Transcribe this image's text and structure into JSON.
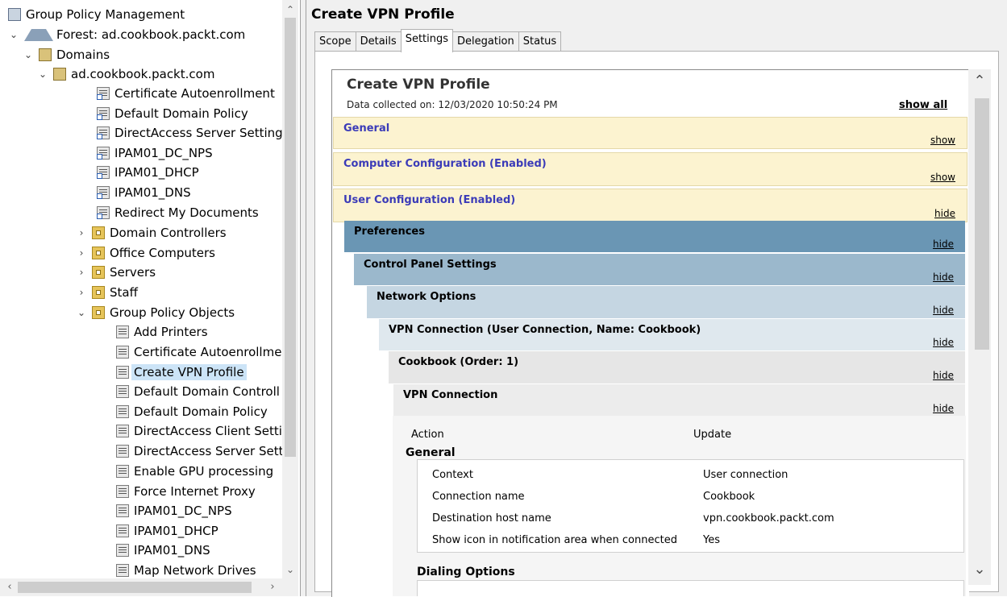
{
  "tree": {
    "root": "Group Policy Management",
    "forest": "Forest: ad.cookbook.packt.com",
    "domains": "Domains",
    "domain": "ad.cookbook.packt.com",
    "linked_gpos": [
      "Certificate Autoenrollment",
      "Default Domain Policy",
      "DirectAccess Server Settings",
      "IPAM01_DC_NPS",
      "IPAM01_DHCP",
      "IPAM01_DNS",
      "Redirect My Documents"
    ],
    "ous": [
      "Domain Controllers",
      "Office Computers",
      "Servers",
      "Staff"
    ],
    "gpo_container": "Group Policy Objects",
    "gpos": [
      "Add Printers",
      "Certificate Autoenrollme",
      "Create VPN Profile",
      "Default Domain Controll",
      "Default Domain Policy",
      "DirectAccess Client Setti",
      "DirectAccess Server Setti",
      "Enable GPU processing",
      "Force Internet Proxy",
      "IPAM01_DC_NPS",
      "IPAM01_DHCP",
      "IPAM01_DNS",
      "Map Network Drives"
    ],
    "selected": "Create VPN Profile"
  },
  "details": {
    "title": "Create VPN Profile",
    "tabs": [
      "Scope",
      "Details",
      "Settings",
      "Delegation",
      "Status"
    ],
    "active_tab": "Settings"
  },
  "report": {
    "title": "Create VPN Profile",
    "collected": "Data collected on: 12/03/2020 10:50:24 PM",
    "show_all": "show all",
    "sections": [
      {
        "title": "General",
        "toggle": "show"
      },
      {
        "title": "Computer Configuration (Enabled)",
        "toggle": "show"
      },
      {
        "title": "User Configuration (Enabled)",
        "toggle": "hide"
      },
      {
        "title": "Preferences",
        "toggle": "hide"
      },
      {
        "title": "Control Panel Settings",
        "toggle": "hide"
      },
      {
        "title": "Network Options",
        "toggle": "hide"
      },
      {
        "title": "VPN Connection (User Connection, Name: Cookbook)",
        "toggle": "hide"
      },
      {
        "title": "Cookbook (Order: 1)",
        "toggle": "hide"
      },
      {
        "title": "VPN Connection",
        "toggle": "hide"
      }
    ],
    "action_label": "Action",
    "action_value": "Update",
    "general_header": "General",
    "general_rows": [
      {
        "k": "Context",
        "v": "User connection"
      },
      {
        "k": "Connection name",
        "v": "Cookbook"
      },
      {
        "k": "Destination host name",
        "v": "vpn.cookbook.packt.com"
      },
      {
        "k": "Show icon in notification area when connected",
        "v": "Yes"
      }
    ],
    "dialing_header": "Dialing Options"
  }
}
